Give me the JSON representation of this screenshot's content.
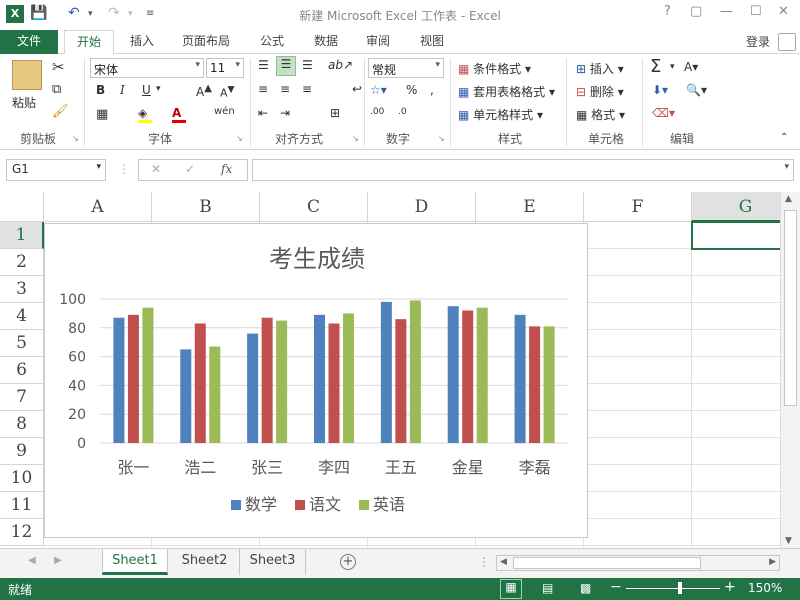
{
  "window": {
    "title": "新建 Microsoft Excel 工作表 - Excel",
    "help": "?",
    "minimize": "—",
    "maximize": "☐",
    "close": "✕"
  },
  "ribbon_tabs": [
    "文件",
    "开始",
    "插入",
    "页面布局",
    "公式",
    "数据",
    "审阅",
    "视图"
  ],
  "account": "登录",
  "clipboard": {
    "paste": "粘贴",
    "label": "剪贴板"
  },
  "font": {
    "name": "宋体",
    "size": "11",
    "label": "字体",
    "bold": "B",
    "italic": "I",
    "underline": "U",
    "phonetic": "wén"
  },
  "alignment": {
    "label": "对齐方式"
  },
  "number": {
    "format": "常规",
    "label": "数字",
    "percent": "%"
  },
  "styles": {
    "conditional": "条件格式",
    "table": "套用表格格式",
    "cell": "单元格样式",
    "label": "样式"
  },
  "cells": {
    "insert": "插入",
    "delete": "删除",
    "format": "格式",
    "label": "单元格"
  },
  "editing": {
    "label": "编辑"
  },
  "formula_bar": {
    "name_box": "G1",
    "fx": "fx"
  },
  "columns": [
    "A",
    "B",
    "C",
    "D",
    "E",
    "F",
    "G"
  ],
  "rows": [
    "1",
    "2",
    "3",
    "4",
    "5",
    "6",
    "7",
    "8",
    "9",
    "10",
    "11",
    "12"
  ],
  "sheets": [
    "Sheet1",
    "Sheet2",
    "Sheet3"
  ],
  "status": {
    "ready": "就绪",
    "zoom": "150%"
  },
  "colors": {
    "accent": "#217346",
    "series": [
      "#4F81BD",
      "#C0504D",
      "#9BBB59"
    ]
  },
  "chart_data": {
    "type": "bar",
    "title": "考生成绩",
    "categories": [
      "张一",
      "浩二",
      "张三",
      "李四",
      "王五",
      "金星",
      "李磊"
    ],
    "series": [
      {
        "name": "数学",
        "values": [
          87,
          65,
          76,
          89,
          98,
          95,
          89
        ]
      },
      {
        "name": "语文",
        "values": [
          89,
          83,
          87,
          83,
          86,
          92,
          81
        ]
      },
      {
        "name": "英语",
        "values": [
          94,
          67,
          85,
          90,
          99,
          94,
          81
        ]
      }
    ],
    "ylim": [
      0,
      100
    ],
    "yticks": [
      0,
      20,
      40,
      60,
      80,
      100
    ],
    "legend": "bottom",
    "grid": true
  }
}
